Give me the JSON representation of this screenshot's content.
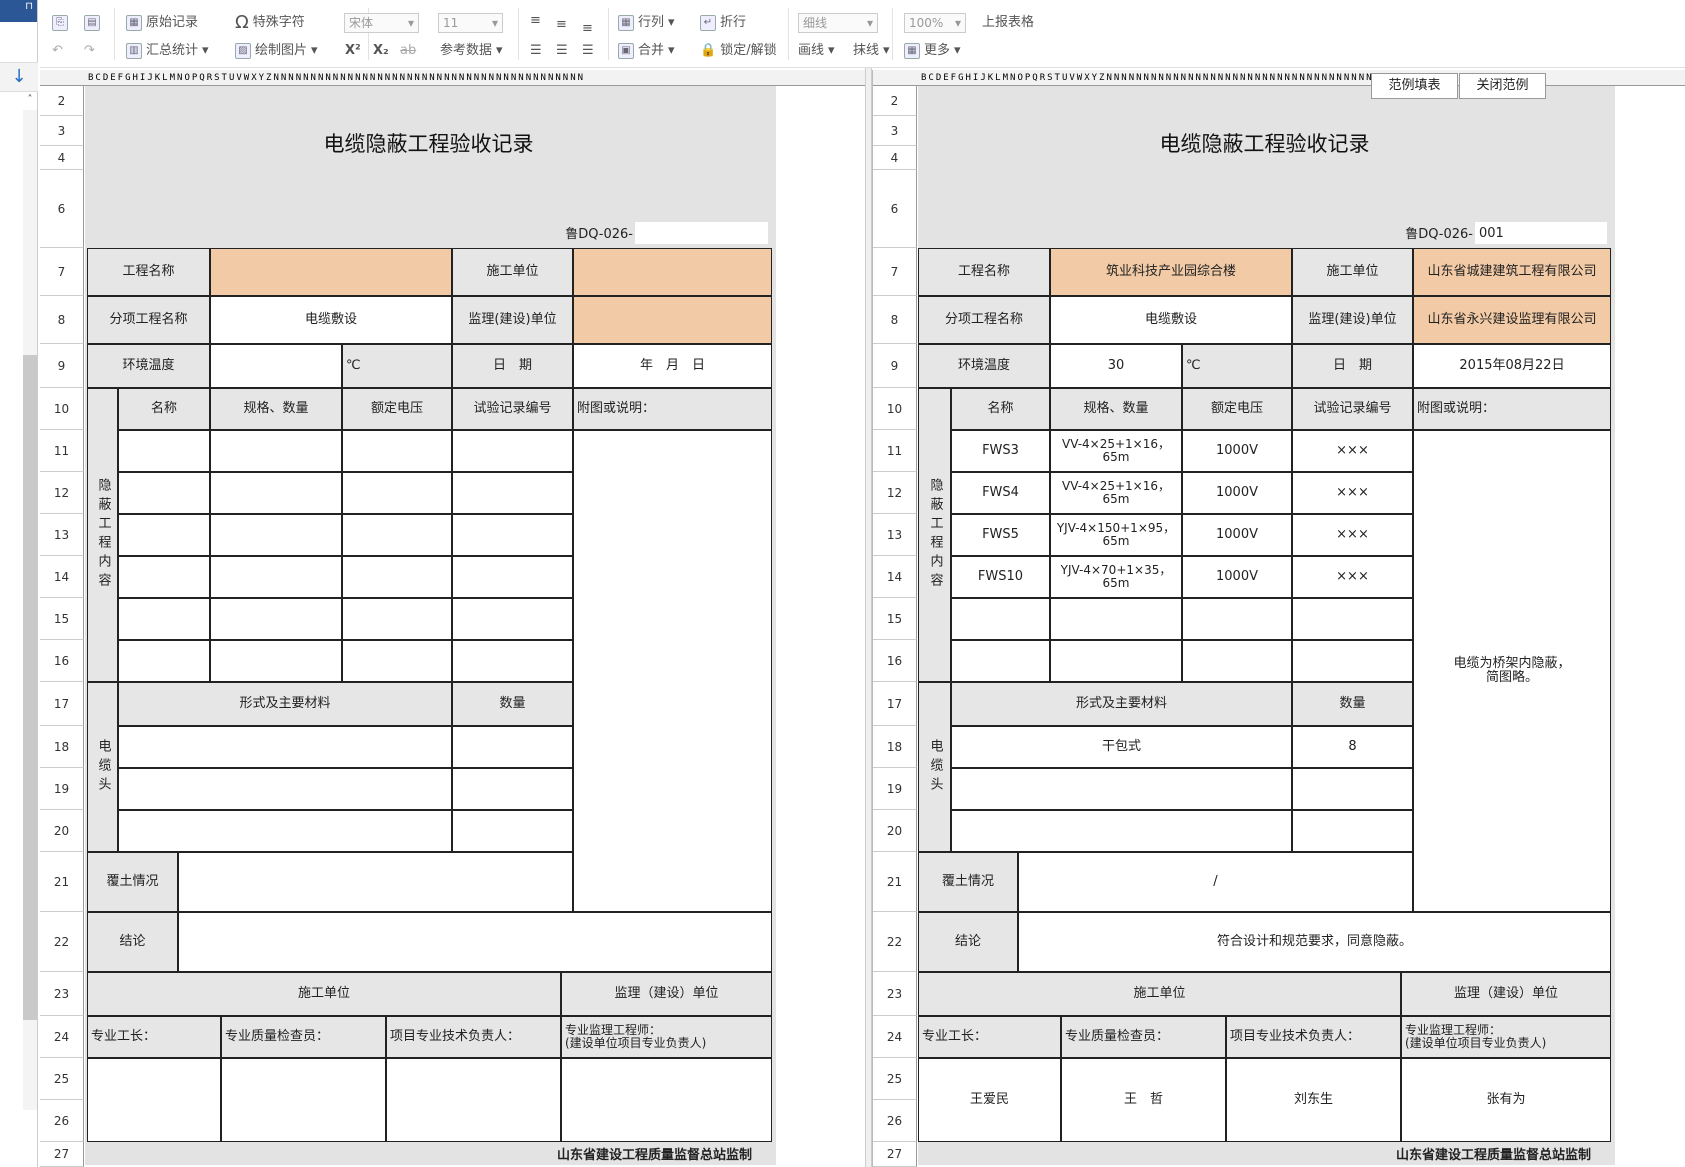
{
  "toolbar": {
    "original_record": "原始记录",
    "special_char": "特殊字符",
    "summary_stats": "汇总统计",
    "draw_picture": "绘制图片",
    "font_name": "宋体",
    "font_size": "11",
    "reference_data": "参考数据",
    "row_col": "行列",
    "merge": "合并",
    "wrap": "折行",
    "lock_unlock": "锁定/解锁",
    "line_style": "细线",
    "draw_line": "画线",
    "erase_line": "抹线",
    "zoom": "100%",
    "more": "更多",
    "report_form": "上报表格",
    "superscript": "X²",
    "subscript": "X₂",
    "strike": "ab"
  },
  "col_header_letters": "BCDEFGHIJKLMNOPQRSTUVWXYZNNNNNNNNNNNNNNNNNNNNNNNNNNNNNNNNNNNNNNNNNN",
  "row_numbers": [
    "2",
    "3",
    "4",
    "6",
    "7",
    "8",
    "9",
    "10",
    "11",
    "12",
    "13",
    "14",
    "15",
    "16",
    "17",
    "18",
    "19",
    "20",
    "21",
    "22",
    "23",
    "24",
    "25",
    "26",
    "27"
  ],
  "example_buttons": {
    "fill": "范例填表",
    "close": "关闭范例"
  },
  "form_left": {
    "title": "电缆隐蔽工程验收记录",
    "code_label": "鲁DQ-026-",
    "code_value": "",
    "project_name_label": "工程名称",
    "project_name": "",
    "construction_unit_label": "施工单位",
    "construction_unit": "",
    "sub_project_label": "分项工程名称",
    "sub_project": "电缆敷设",
    "supervision_label": "监理(建设)单位",
    "supervision_unit": "",
    "temp_label": "环境温度",
    "temp_value": "",
    "temp_unit": "℃",
    "date_label": "日　期",
    "date_value": "年　月　日",
    "hidden_label": "隐蔽工程内容",
    "col_name": "名称",
    "col_spec": "规格、数量",
    "col_voltage": "额定电压",
    "col_test": "试验记录编号",
    "notes_label": "附图或说明：",
    "notes_value": "",
    "rows": [
      {
        "name": "",
        "spec": "",
        "voltage": "",
        "test": ""
      },
      {
        "name": "",
        "spec": "",
        "voltage": "",
        "test": ""
      },
      {
        "name": "",
        "spec": "",
        "voltage": "",
        "test": ""
      },
      {
        "name": "",
        "spec": "",
        "voltage": "",
        "test": ""
      },
      {
        "name": "",
        "spec": "",
        "voltage": "",
        "test": ""
      },
      {
        "name": "",
        "spec": "",
        "voltage": "",
        "test": ""
      },
      {
        "name": "",
        "spec": "",
        "voltage": "",
        "test": ""
      }
    ],
    "cable_head_label": "电缆头",
    "form_material_label": "形式及主要材料",
    "quantity_label": "数量",
    "head_rows": [
      {
        "material": "",
        "qty": ""
      },
      {
        "material": "",
        "qty": ""
      },
      {
        "material": "",
        "qty": ""
      }
    ],
    "backfill_label": "覆土情况",
    "backfill_value": "",
    "conclusion_label": "结论",
    "conclusion_value": "",
    "sig_construction": "施工单位",
    "sig_supervision": "监理（建设）单位",
    "sig_foreman": "专业工长：",
    "sig_inspector": "专业质量检查员：",
    "sig_tech": "项目专业技术负责人：",
    "sig_engineer": "专业监理工程师：\n(建设单位项目专业负责人)",
    "name_foreman": "",
    "name_inspector": "",
    "name_tech": "",
    "name_engineer": "",
    "footer": "山东省建设工程质量监督总站监制"
  },
  "form_right": {
    "title": "电缆隐蔽工程验收记录",
    "code_label": "鲁DQ-026-",
    "code_value": "001",
    "project_name_label": "工程名称",
    "project_name": "筑业科技产业园综合楼",
    "construction_unit_label": "施工单位",
    "construction_unit": "山东省城建建筑工程有限公司",
    "sub_project_label": "分项工程名称",
    "sub_project": "电缆敷设",
    "supervision_label": "监理(建设)单位",
    "supervision_unit": "山东省永兴建设监理有限公司",
    "temp_label": "环境温度",
    "temp_value": "30",
    "temp_unit": "℃",
    "date_label": "日　期",
    "date_value": "2015年08月22日",
    "hidden_label": "隐蔽工程内容",
    "col_name": "名称",
    "col_spec": "规格、数量",
    "col_voltage": "额定电压",
    "col_test": "试验记录编号",
    "notes_label": "附图或说明：",
    "notes_value": "电缆为桥架内隐蔽，\n简图略。",
    "rows": [
      {
        "name": "FWS3",
        "spec": "VV-4×25+1×16，\n65m",
        "voltage": "1000V",
        "test": "×××"
      },
      {
        "name": "FWS4",
        "spec": "VV-4×25+1×16，\n65m",
        "voltage": "1000V",
        "test": "×××"
      },
      {
        "name": "FWS5",
        "spec": "YJV-4×150+1×95，\n65m",
        "voltage": "1000V",
        "test": "×××"
      },
      {
        "name": "FWS10",
        "spec": "YJV-4×70+1×35，\n65m",
        "voltage": "1000V",
        "test": "×××"
      },
      {
        "name": "",
        "spec": "",
        "voltage": "",
        "test": ""
      },
      {
        "name": "",
        "spec": "",
        "voltage": "",
        "test": ""
      },
      {
        "name": "",
        "spec": "",
        "voltage": "",
        "test": ""
      }
    ],
    "cable_head_label": "电缆头",
    "form_material_label": "形式及主要材料",
    "quantity_label": "数量",
    "head_rows": [
      {
        "material": "干包式",
        "qty": "8"
      },
      {
        "material": "",
        "qty": ""
      },
      {
        "material": "",
        "qty": ""
      }
    ],
    "backfill_label": "覆土情况",
    "backfill_value": "/",
    "conclusion_label": "结论",
    "conclusion_value": "符合设计和规范要求，同意隐蔽。",
    "sig_construction": "施工单位",
    "sig_supervision": "监理（建设）单位",
    "sig_foreman": "专业工长：",
    "sig_inspector": "专业质量检查员：",
    "sig_tech": "项目专业技术负责人：",
    "sig_engineer": "专业监理工程师：\n(建设单位项目专业负责人)",
    "name_foreman": "王爱民",
    "name_inspector": "王　哲",
    "name_tech": "刘东生",
    "name_engineer": "张有为",
    "footer": "山东省建设工程质量监督总站监制"
  }
}
